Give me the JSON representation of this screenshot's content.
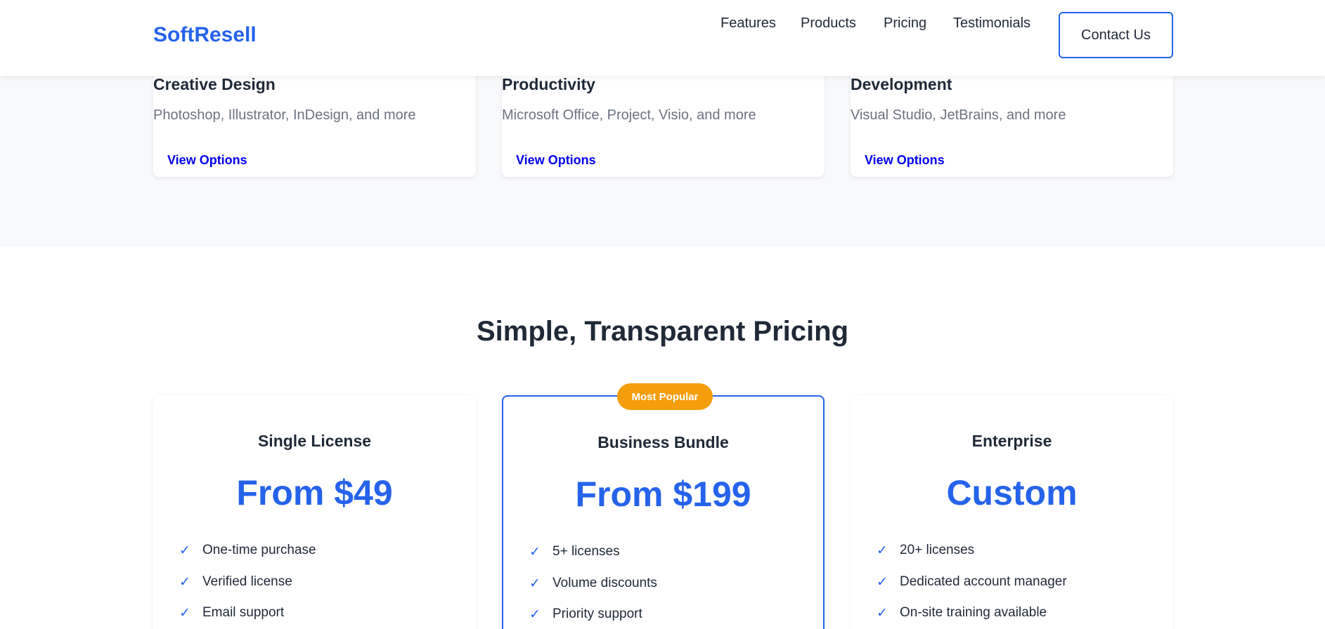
{
  "header": {
    "logo": "SoftResell",
    "nav": [
      "Features",
      "Products",
      "Pricing",
      "Testimonials"
    ],
    "contact_label": "Contact Us"
  },
  "categories": [
    {
      "title": "Creative Design",
      "description": "Photoshop, Illustrator, InDesign, and more",
      "link": "View Options"
    },
    {
      "title": "Productivity",
      "description": "Microsoft Office, Project, Visio, and more",
      "link": "View Options"
    },
    {
      "title": "Development",
      "description": "Visual Studio, JetBrains, and more",
      "link": "View Options"
    }
  ],
  "pricing": {
    "title": "Simple, Transparent Pricing",
    "plans": [
      {
        "name": "Single License",
        "price": "From $49",
        "badge": "",
        "features": [
          "One-time purchase",
          "Verified license",
          "Email support"
        ]
      },
      {
        "name": "Business Bundle",
        "price": "From $199",
        "badge": "Most Popular",
        "features": [
          "5+ licenses",
          "Volume discounts",
          "Priority support"
        ]
      },
      {
        "name": "Enterprise",
        "price": "Custom",
        "badge": "",
        "features": [
          "20+ licenses",
          "Dedicated account manager",
          "On-site training available"
        ]
      }
    ]
  },
  "icons": {
    "check": "check-icon"
  },
  "colors": {
    "accent": "#2563eb",
    "badge": "#f59e0b",
    "link": "#0000ee",
    "section_bg": "#f8f9fb"
  }
}
